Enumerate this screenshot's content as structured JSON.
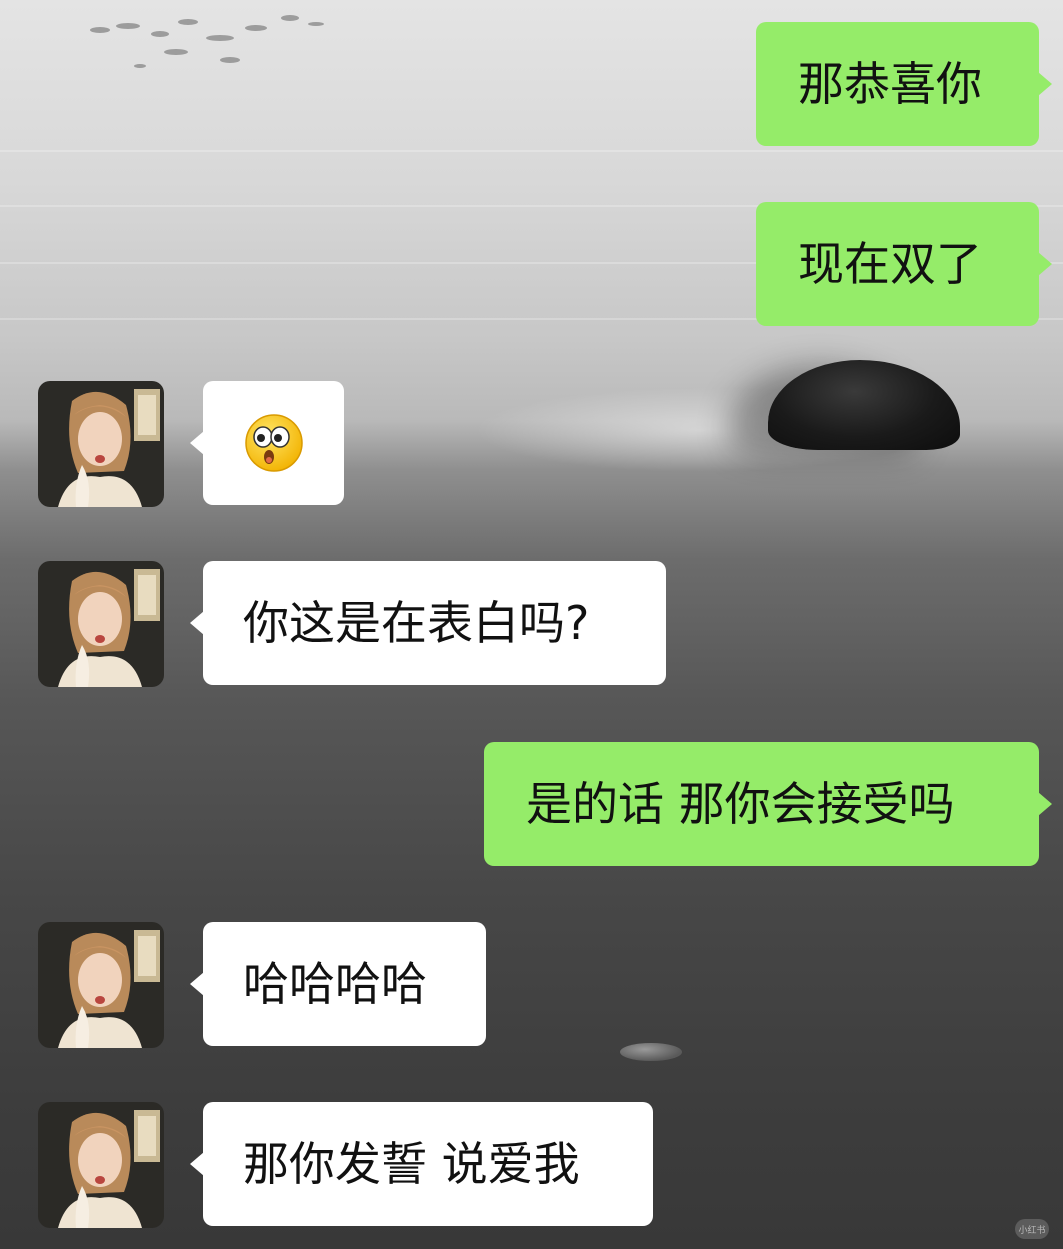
{
  "chat": {
    "messages": [
      {
        "side": "out",
        "text": "那恭喜你"
      },
      {
        "side": "out",
        "text": "现在双了"
      },
      {
        "side": "in",
        "emoji": "surprised-face-emoji"
      },
      {
        "side": "in",
        "text": "你这是在表白吗?"
      },
      {
        "side": "out",
        "text": "是的话 那你会接受吗"
      },
      {
        "side": "in",
        "text": "哈哈哈哈"
      },
      {
        "side": "in",
        "text": "那你发誓 说爱我"
      }
    ]
  },
  "watermark": {
    "label": "小红书"
  },
  "colors": {
    "outgoing_bubble": "#95ec69",
    "incoming_bubble": "#ffffff",
    "text": "#111111"
  }
}
